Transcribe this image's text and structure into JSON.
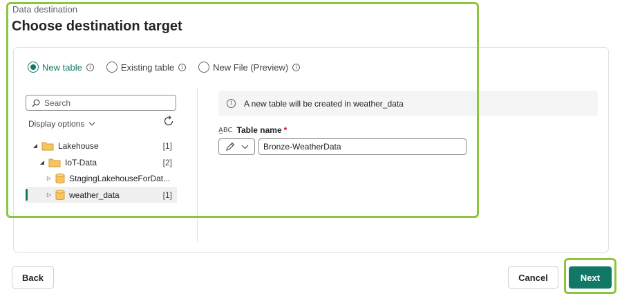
{
  "header": {
    "eyebrow": "Data destination",
    "title": "Choose destination target"
  },
  "target_options": [
    {
      "label": "New table",
      "selected": true,
      "info_icon": "info-icon"
    },
    {
      "label": "Existing table",
      "selected": false,
      "info_icon": "info-icon"
    },
    {
      "label": "New File (Preview)",
      "selected": false,
      "info_icon": "info-icon"
    }
  ],
  "navigator": {
    "search_placeholder": "Search",
    "display_options_label": "Display options",
    "tree": [
      {
        "label": "Lakehouse",
        "count": "[1]",
        "type": "folder",
        "expanded": true
      },
      {
        "label": "IoT-Data",
        "count": "[2]",
        "type": "folder",
        "expanded": true
      },
      {
        "label": "StagingLakehouseForDat...",
        "count": "",
        "type": "database",
        "expanded": false
      },
      {
        "label": "weather_data",
        "count": "[1]",
        "type": "database",
        "expanded": false,
        "selected": true
      }
    ]
  },
  "details": {
    "banner_text": "A new table will be created in weather_data",
    "field_label": "Table name",
    "required_mark": "*",
    "table_name_value": "Bronze-WeatherData"
  },
  "footer": {
    "back_label": "Back",
    "cancel_label": "Cancel",
    "next_label": "Next"
  },
  "colors": {
    "accent": "#117865",
    "highlight": "#8cc63f",
    "folder": "#f5b94a"
  }
}
